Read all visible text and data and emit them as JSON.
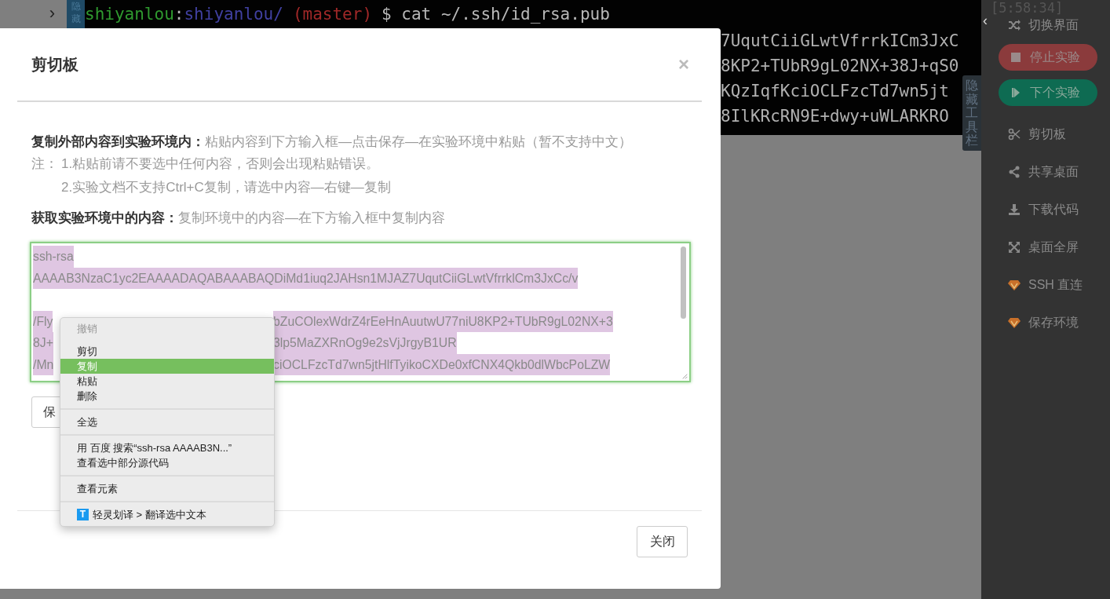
{
  "terminal": {
    "chevron": "›",
    "hide_tab": "隐藏",
    "prompt_user": "shiyanlou",
    "prompt_sep": ":",
    "prompt_path": "shiyanlou/",
    "prompt_branch": "(master)",
    "command": "$ cat ~/.ssh/id_rsa.pub",
    "output_lines": [
      "7UqutCiiGLwtVfrrkICm3JxC",
      "8KP2+TUbR9gL02NX+38J+qS0",
      "KQzIqfKciOCLFzcTd7wn5jt",
      "8IlKRcRN9E+dwy+uWLARKRO"
    ]
  },
  "toolbar_toggle": "隐藏工具栏",
  "sidebar": {
    "collapse": "‹",
    "timestamp": "[5:58:34]",
    "items": [
      {
        "kind": "link",
        "label": "切换界面"
      },
      {
        "kind": "danger",
        "label": "停止实验"
      },
      {
        "kind": "success",
        "label": "下个实验"
      },
      {
        "kind": "link",
        "label": "剪切板"
      },
      {
        "kind": "link",
        "label": "共享桌面"
      },
      {
        "kind": "link",
        "label": "下载代码"
      },
      {
        "kind": "link",
        "label": "桌面全屏"
      },
      {
        "kind": "link",
        "label": "SSH 直连"
      },
      {
        "kind": "link",
        "label": "保存环境"
      }
    ]
  },
  "modal": {
    "title": "剪切板",
    "close": "×",
    "paste_heading": "复制外部内容到实验环境内：",
    "paste_text": "粘贴内容到下方输入框—点击保存—在实验环境中粘贴（暂不支持中文）",
    "note_label": "注：",
    "notes": [
      "1.粘贴前请不要选中任何内容，否则会出现粘贴错误。",
      "2.实验文档不支持Ctrl+C复制，请选中内容—右键—复制"
    ],
    "copy_heading": "获取实验环境中的内容：",
    "copy_text": "复制环境中的内容—在下方输入框中复制内容",
    "textarea_lines": [
      {
        "text": "ssh-rsa"
      },
      {
        "text": "AAAAB3NzaC1yc2EAAAADAQABAAABAQDiMd1iuq2JAHsn1MJAZ7UqutCiiGLwtVfrrklCm3JxCc/v"
      },
      {
        "start": "/Fly",
        "end": "bZuCOlexWdrZ4rEeHnAuutwU77niU8KP2+TUbR9gL02NX+3"
      },
      {
        "start": "8J+",
        "end": "3lp5MaZXRnOg9e2sVjJrgyB1UR"
      },
      {
        "start": "/Mn",
        "end": "ciOCLFzcTd7wn5jtHlfTyikoCXDe0xfCNX4Qkb0dlWbcPoLZW"
      }
    ],
    "save_button": "保",
    "close_button": "关闭"
  },
  "context_menu": {
    "items": [
      {
        "kind": "item",
        "label": "撤销",
        "disabled": true,
        "selected": false
      },
      {
        "kind": "gap"
      },
      {
        "kind": "item",
        "label": "剪切",
        "disabled": false,
        "selected": false
      },
      {
        "kind": "item",
        "label": "复制",
        "disabled": false,
        "selected": true
      },
      {
        "kind": "item",
        "label": "粘贴",
        "disabled": false,
        "selected": false
      },
      {
        "kind": "item",
        "label": "删除",
        "disabled": false,
        "selected": false
      },
      {
        "kind": "separator"
      },
      {
        "kind": "item",
        "label": "全选",
        "disabled": false,
        "selected": false
      },
      {
        "kind": "separator"
      },
      {
        "kind": "item",
        "label": "用 百度 搜索“ssh-rsa AAAAB3N...”",
        "disabled": false,
        "selected": false
      },
      {
        "kind": "item",
        "label": "查看选中部分源代码",
        "disabled": false,
        "selected": false
      },
      {
        "kind": "separator"
      },
      {
        "kind": "item",
        "label": "查看元素",
        "disabled": false,
        "selected": false
      },
      {
        "kind": "separator"
      },
      {
        "kind": "item",
        "label": "轻灵划译 > 翻译选中文本",
        "badge": "T",
        "disabled": false,
        "selected": false
      }
    ]
  }
}
